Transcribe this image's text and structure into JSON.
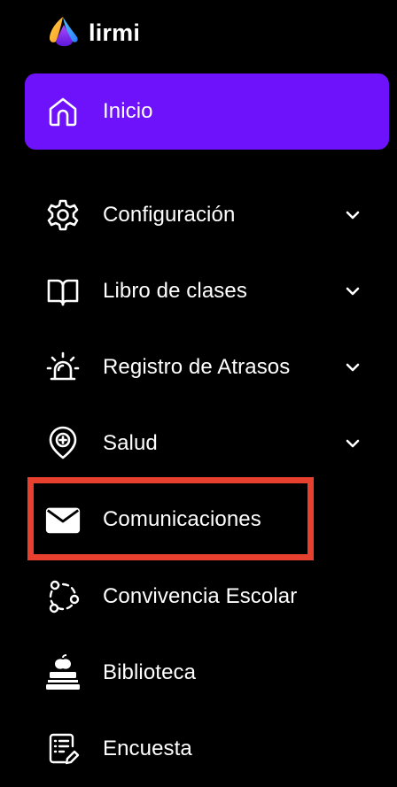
{
  "brand": {
    "name": "lirmi",
    "logo_icon": "lirmi-logo-icon"
  },
  "colors": {
    "background": "#000000",
    "active_item": "#6d12fb",
    "text": "#ffffff",
    "highlight_border": "#e8402f"
  },
  "nav": {
    "items": [
      {
        "label": "Inicio",
        "icon": "home-icon",
        "active": true,
        "has_submenu": false
      },
      {
        "label": "Configuración",
        "icon": "gear-icon",
        "active": false,
        "has_submenu": true
      },
      {
        "label": "Libro de clases",
        "icon": "book-icon",
        "active": false,
        "has_submenu": true
      },
      {
        "label": "Registro de Atrasos",
        "icon": "alarm-light-icon",
        "active": false,
        "has_submenu": true
      },
      {
        "label": "Salud",
        "icon": "health-pin-icon",
        "active": false,
        "has_submenu": true
      },
      {
        "label": "Comunicaciones",
        "icon": "envelope-icon",
        "active": false,
        "has_submenu": false,
        "highlighted": true
      },
      {
        "label": "Convivencia Escolar",
        "icon": "network-circle-icon",
        "active": false,
        "has_submenu": false
      },
      {
        "label": "Biblioteca",
        "icon": "books-apple-icon",
        "active": false,
        "has_submenu": false
      },
      {
        "label": "Encuesta",
        "icon": "survey-edit-icon",
        "active": false,
        "has_submenu": false
      }
    ]
  }
}
